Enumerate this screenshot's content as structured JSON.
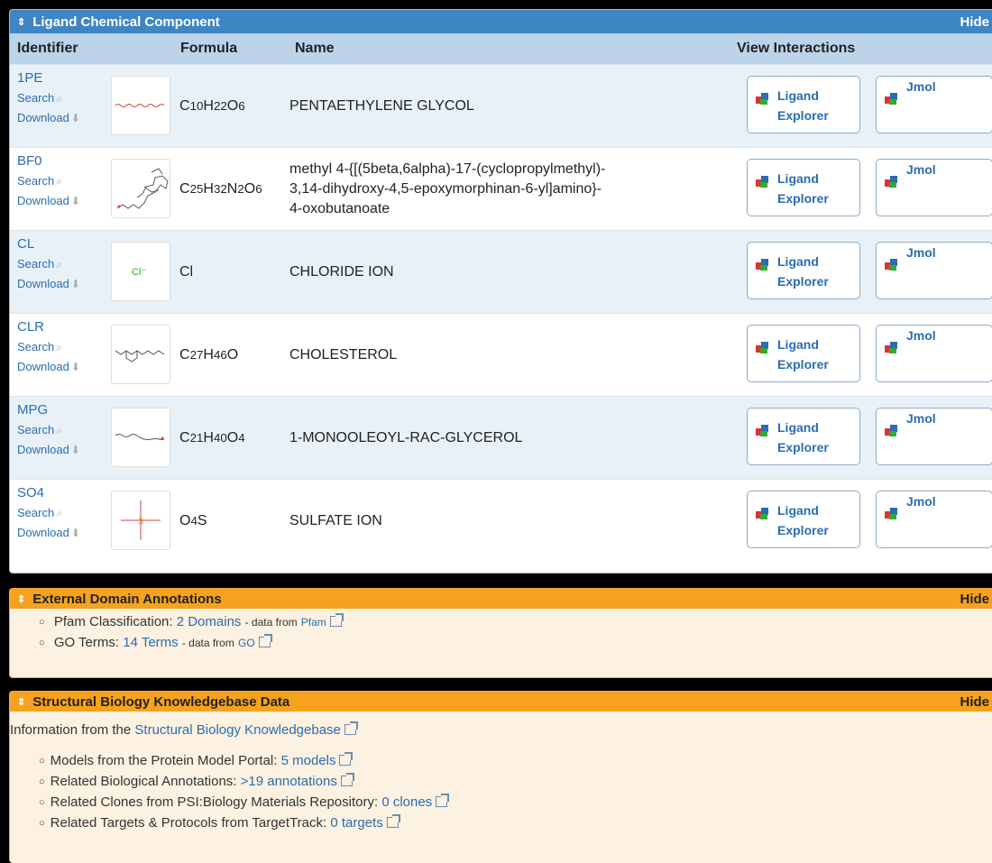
{
  "ligand_panel": {
    "toggle": "⇕",
    "title": "Ligand Chemical Component",
    "hide_label": "Hide",
    "columns": {
      "identifier": "Identifier",
      "formula": "Formula",
      "name": "Name",
      "view": "View Interactions"
    },
    "search_label": "Search",
    "download_label": "Download",
    "ligand_explorer_line1": "Ligand",
    "ligand_explorer_line2": "Explorer",
    "jmol_label": "Jmol",
    "rows": [
      {
        "id": "1PE",
        "formula": [
          "C",
          "10",
          " H",
          "22",
          " O",
          "6"
        ],
        "name": "PENTAETHYLENE GLYCOL"
      },
      {
        "id": "BF0",
        "formula": [
          "C",
          "25",
          " H",
          "32",
          " N",
          "2",
          " O",
          "6"
        ],
        "name_lines": [
          "methyl 4-{[(5beta,6alpha)-17-(cyclopropylmethyl)-",
          "3,14-dihydroxy-4,5-epoxymorphinan-6-yl]amino}-",
          "4-oxobutanoate"
        ]
      },
      {
        "id": "CL",
        "formula_text": "Cl",
        "name": "CHLORIDE ION",
        "thumb_label": "Cl⁻"
      },
      {
        "id": "CLR",
        "formula": [
          "C",
          "27",
          " H",
          "46",
          " O",
          ""
        ],
        "name": "CHOLESTEROL"
      },
      {
        "id": "MPG",
        "formula": [
          "C",
          "21",
          " H",
          "40",
          " O",
          "4"
        ],
        "name": "1-MONOOLEOYL-RAC-GLYCEROL"
      },
      {
        "id": "SO4",
        "formula": [
          "O",
          "4",
          " S",
          ""
        ],
        "name": "SULFATE ION"
      }
    ]
  },
  "external_panel": {
    "toggle": "⇕",
    "title": "External Domain Annotations",
    "hide_label": "Hide",
    "pfam": {
      "label": "Pfam Classification:",
      "link": "2 Domains",
      "note": "- data from",
      "source": "Pfam"
    },
    "go": {
      "label": "GO Terms:",
      "link": "14 Terms",
      "note": "- data from",
      "source": "GO"
    }
  },
  "sbkb_panel": {
    "toggle": "⇕",
    "title": "Structural Biology Knowledgebase Data",
    "hide_label": "Hide",
    "intro": "Information from the",
    "intro_link": "Structural Biology Knowledgebase",
    "items": [
      {
        "label": "Models from the Protein Model Portal:",
        "link": "5 models"
      },
      {
        "label": "Related Biological Annotations:",
        "link": ">19 annotations"
      },
      {
        "label": "Related Clones from PSI:Biology Materials Repository:",
        "link": "0 clones"
      },
      {
        "label": "Related Targets & Protocols from TargetTrack:",
        "link": "0 targets"
      }
    ]
  }
}
